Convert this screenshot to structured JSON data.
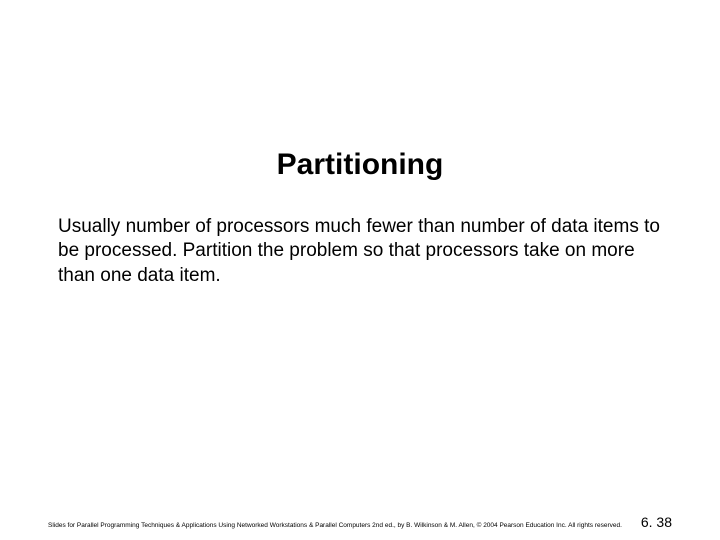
{
  "slide": {
    "title": "Partitioning",
    "body": "Usually number of processors much fewer than number of data items to be processed. Partition the problem so that processors take on more than one data item.",
    "footer_credit": "Slides for Parallel Programming Techniques & Applications Using Networked Workstations & Parallel Computers 2nd ed., by B. Wilkinson & M. Allen, © 2004 Pearson Education Inc. All rights reserved.",
    "page_number": "6. 38"
  }
}
